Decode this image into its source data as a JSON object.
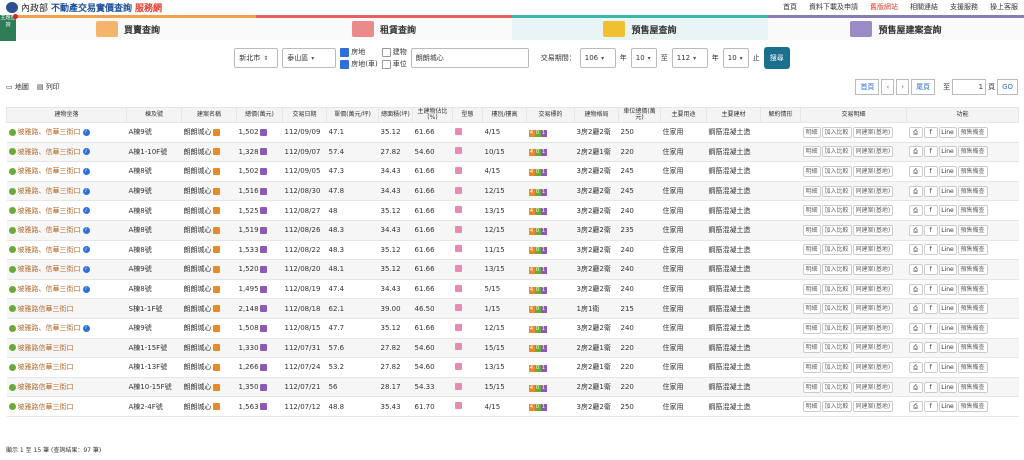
{
  "header": {
    "ministry": "內政部",
    "brand": "不動產交易實價查詢",
    "brand_accent": "服務網",
    "nav": [
      "首頁",
      "資料下載及申請",
      "舊版網站",
      "相關連結",
      "支援服務",
      "操上客服"
    ]
  },
  "side_badge": "主題查詢",
  "tabs": [
    {
      "label": "買賣查詢"
    },
    {
      "label": "租賃查詢"
    },
    {
      "label": "預售屋查詢"
    },
    {
      "label": "預售屋建案查詢"
    }
  ],
  "filters": {
    "city": "新北市",
    "district": "泰山區",
    "opt_land": "房地",
    "opt_land_car": "房地(車)",
    "opt_building": "建物",
    "opt_parking": "車位",
    "keyword": "朗朗城心",
    "period_label": "交易期間：",
    "y1": "106",
    "m1": "10",
    "to": "至",
    "y2": "112",
    "m2": "10",
    "unit_year": "年",
    "unit_end": "止",
    "search": "搜尋"
  },
  "toolbar": {
    "map": "地圖",
    "print": "列印",
    "first": "首頁",
    "prev": "‹",
    "next": "›",
    "last": "尾頁",
    "to": "至",
    "page": "1",
    "page_unit": "頁",
    "go": "GO"
  },
  "columns": [
    "建物坐落",
    "棟及號",
    "建案名稱",
    "總價(萬元)",
    "交易日期",
    "單價(萬元/坪)",
    "總面積(坪)",
    "主建物佔比(%)",
    "型態",
    "樓別/樓高",
    "交易標的",
    "建物格局",
    "車位總價(萬元)",
    "主要用途",
    "主要建材",
    "解約情形",
    "交易明細",
    "功能"
  ],
  "rows": [
    {
      "addr": "坡雅路、信華三街口",
      "bld": "A棟9號",
      "proj": "朗朗城心",
      "total": "1,502",
      "date": "112/09/09",
      "unit": "47.1",
      "area": "35.12",
      "ratio": "61.66",
      "floor": "4/15",
      "layout": "3房2廳2衛",
      "park": "250",
      "use": "住家用",
      "mat": "鋼筋混凝土造",
      "info": true
    },
    {
      "addr": "坡雅路、信華三街口",
      "bld": "A棟1-10F號",
      "proj": "朗朗城心",
      "total": "1,328",
      "date": "112/09/07",
      "unit": "57.4",
      "area": "27.82",
      "ratio": "54.60",
      "floor": "10/15",
      "layout": "2房2廳1衛",
      "park": "220",
      "use": "住家用",
      "mat": "鋼筋混凝土造",
      "info": true
    },
    {
      "addr": "坡雅路、信華三街口",
      "bld": "A棟8號",
      "proj": "朗朗城心",
      "total": "1,502",
      "date": "112/09/05",
      "unit": "47.3",
      "area": "34.43",
      "ratio": "61.66",
      "floor": "4/15",
      "layout": "3房2廳2衛",
      "park": "245",
      "use": "住家用",
      "mat": "鋼筋混凝土造",
      "info": true
    },
    {
      "addr": "坡雅路、信華三街口",
      "bld": "A棟9號",
      "proj": "朗朗城心",
      "total": "1,516",
      "date": "112/08/30",
      "unit": "47.8",
      "area": "34.43",
      "ratio": "61.66",
      "floor": "12/15",
      "layout": "3房2廳2衛",
      "park": "245",
      "use": "住家用",
      "mat": "鋼筋混凝土造",
      "info": true
    },
    {
      "addr": "坡雅路、信華三街口",
      "bld": "A棟8號",
      "proj": "朗朗城心",
      "total": "1,525",
      "date": "112/08/27",
      "unit": "48",
      "area": "35.12",
      "ratio": "61.66",
      "floor": "13/15",
      "layout": "3房2廳2衛",
      "park": "240",
      "use": "住家用",
      "mat": "鋼筋混凝土造",
      "info": true
    },
    {
      "addr": "坡雅路、信華三街口",
      "bld": "A棟8號",
      "proj": "朗朗城心",
      "total": "1,519",
      "date": "112/08/26",
      "unit": "48.3",
      "area": "34.43",
      "ratio": "61.66",
      "floor": "12/15",
      "layout": "3房2廳2衛",
      "park": "235",
      "use": "住家用",
      "mat": "鋼筋混凝土造",
      "info": true
    },
    {
      "addr": "坡雅路、信華三街口",
      "bld": "A棟8號",
      "proj": "朗朗城心",
      "total": "1,533",
      "date": "112/08/22",
      "unit": "48.3",
      "area": "35.12",
      "ratio": "61.66",
      "floor": "11/15",
      "layout": "3房2廳2衛",
      "park": "240",
      "use": "住家用",
      "mat": "鋼筋混凝土造",
      "info": true
    },
    {
      "addr": "坡雅路、信華三街口",
      "bld": "A棟9號",
      "proj": "朗朗城心",
      "total": "1,520",
      "date": "112/08/20",
      "unit": "48.1",
      "area": "35.12",
      "ratio": "61.66",
      "floor": "13/15",
      "layout": "3房2廳2衛",
      "park": "240",
      "use": "住家用",
      "mat": "鋼筋混凝土造",
      "info": true
    },
    {
      "addr": "坡雅路、信華三街口",
      "bld": "A棟8號",
      "proj": "朗朗城心",
      "total": "1,495",
      "date": "112/08/19",
      "unit": "47.4",
      "area": "34.43",
      "ratio": "61.66",
      "floor": "5/15",
      "layout": "3房2廳2衛",
      "park": "240",
      "use": "住家用",
      "mat": "鋼筋混凝土造",
      "info": true
    },
    {
      "addr": "坡雅路信華三街口",
      "bld": "S棟1-1F號",
      "proj": "朗朗城心",
      "total": "2,148",
      "date": "112/08/18",
      "unit": "62.1",
      "area": "39.00",
      "ratio": "46.50",
      "floor": "1/15",
      "layout": "1房1衛",
      "park": "215",
      "use": "住家用",
      "mat": "鋼筋混凝土造",
      "info": false
    },
    {
      "addr": "坡雅路、信華三街口",
      "bld": "A棟9號",
      "proj": "朗朗城心",
      "total": "1,508",
      "date": "112/08/15",
      "unit": "47.7",
      "area": "35.12",
      "ratio": "61.66",
      "floor": "12/15",
      "layout": "3房2廳2衛",
      "park": "240",
      "use": "住家用",
      "mat": "鋼筋混凝土造",
      "info": true
    },
    {
      "addr": "坡雅路信華三街口",
      "bld": "A棟1-15F號",
      "proj": "朗朗城心",
      "total": "1,330",
      "date": "112/07/31",
      "unit": "57.6",
      "area": "27.82",
      "ratio": "54.60",
      "floor": "15/15",
      "layout": "2房2廳1衛",
      "park": "220",
      "use": "住家用",
      "mat": "鋼筋混凝土造",
      "info": false
    },
    {
      "addr": "坡雅路信華三街口",
      "bld": "A棟1-13F號",
      "proj": "朗朗城心",
      "total": "1,266",
      "date": "112/07/24",
      "unit": "53.2",
      "area": "27.82",
      "ratio": "54.60",
      "floor": "13/15",
      "layout": "2房2廳1衛",
      "park": "220",
      "use": "住家用",
      "mat": "鋼筋混凝土造",
      "info": false
    },
    {
      "addr": "坡雅路信華三街口",
      "bld": "A棟10-15F號",
      "proj": "朗朗城心",
      "total": "1,350",
      "date": "112/07/21",
      "unit": "56",
      "area": "28.17",
      "ratio": "54.33",
      "floor": "15/15",
      "layout": "2房2廳1衛",
      "park": "220",
      "use": "住家用",
      "mat": "鋼筋混凝土造",
      "info": false
    },
    {
      "addr": "坡雅路信華三街口",
      "bld": "A棟2-4F號",
      "proj": "朗朗城心",
      "total": "1,563",
      "date": "112/07/12",
      "unit": "48.8",
      "area": "35.43",
      "ratio": "61.70",
      "floor": "4/15",
      "layout": "3房2廳2衛",
      "park": "250",
      "use": "住家用",
      "mat": "鋼筋混凝土造",
      "info": false
    }
  ],
  "row_labels": {
    "mix": [
      "4",
      "0",
      "1"
    ],
    "detail": "明細",
    "compare": "加入比較",
    "same_community": "同建案(基地)",
    "print": "印",
    "fb": "f",
    "line": "Line",
    "presale": "預售備查"
  },
  "footer": "顯示 1 至 15 筆 (查詢結果：97 筆)"
}
